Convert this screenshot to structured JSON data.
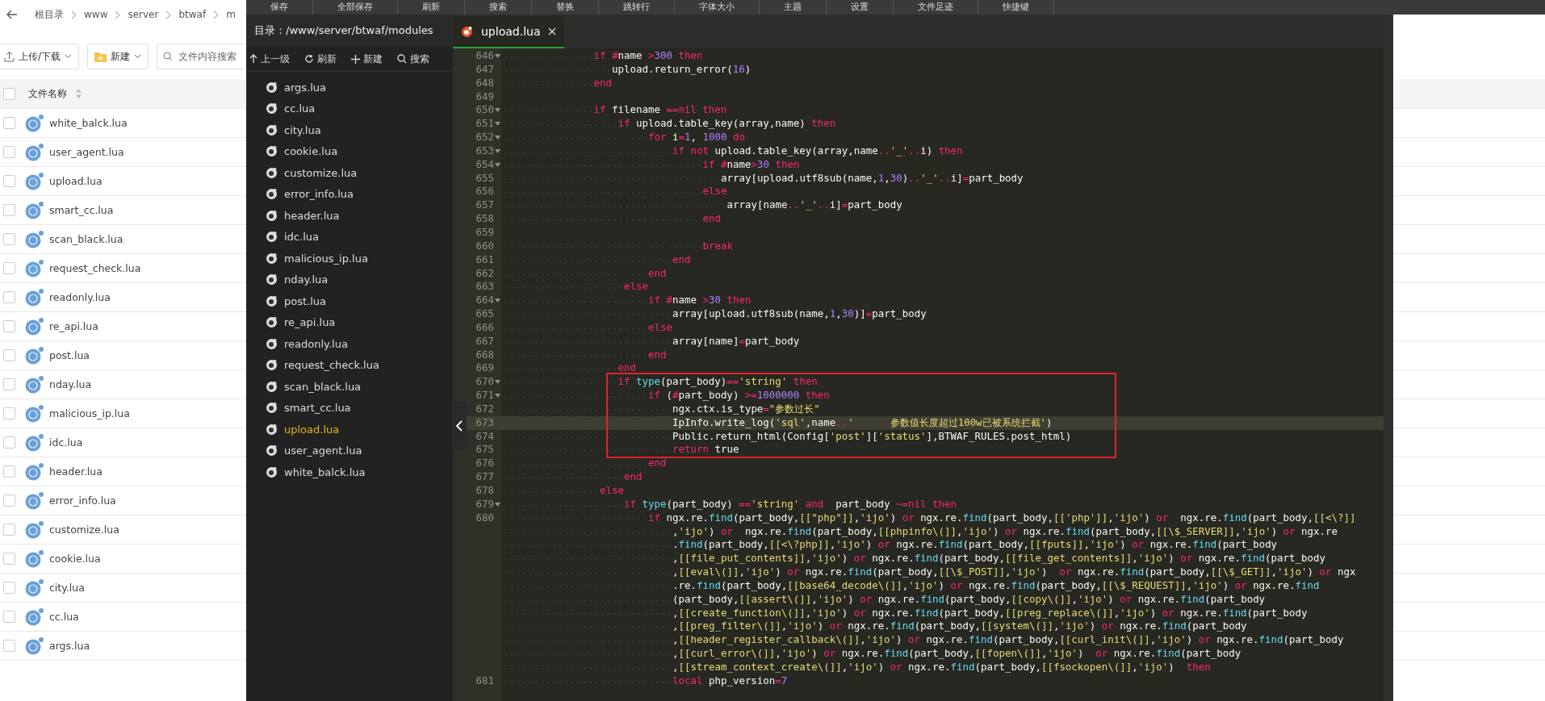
{
  "toolbar": [
    "保存",
    "全部保存",
    "刷新",
    "搜索",
    "替换",
    "跳转行",
    "字体大小",
    "主题",
    "设置",
    "文件足迹",
    "快捷键"
  ],
  "file_manager": {
    "breadcrumb": [
      "根目录",
      "www",
      "server",
      "btwaf",
      "m"
    ],
    "upload_button": "上传/下载",
    "new_button": "新建",
    "search": {
      "placeholder": "文件内容搜索"
    },
    "select_all_checked": false,
    "column": "文件名称",
    "files": [
      {
        "name": "white_balck.lua",
        "checked": false
      },
      {
        "name": "user_agent.lua",
        "checked": false
      },
      {
        "name": "upload.lua",
        "checked": false
      },
      {
        "name": "smart_cc.lua",
        "checked": false
      },
      {
        "name": "scan_black.lua",
        "checked": false
      },
      {
        "name": "request_check.lua",
        "checked": false
      },
      {
        "name": "readonly.lua",
        "checked": false
      },
      {
        "name": "re_api.lua",
        "checked": false
      },
      {
        "name": "post.lua",
        "checked": false
      },
      {
        "name": "nday.lua",
        "checked": false
      },
      {
        "name": "malicious_ip.lua",
        "checked": false
      },
      {
        "name": "idc.lua",
        "checked": false
      },
      {
        "name": "header.lua",
        "checked": false
      },
      {
        "name": "error_info.lua",
        "checked": false
      },
      {
        "name": "customize.lua",
        "checked": false
      },
      {
        "name": "cookie.lua",
        "checked": false
      },
      {
        "name": "city.lua",
        "checked": false
      },
      {
        "name": "cc.lua",
        "checked": false
      },
      {
        "name": "args.lua",
        "checked": false
      }
    ]
  },
  "editor": {
    "directory": "目录：/www/server/btwaf/modules",
    "actions": [
      "上一级",
      "刷新",
      "新建",
      "搜索"
    ],
    "files": [
      {
        "name": "args.lua",
        "selected": false
      },
      {
        "name": "cc.lua",
        "selected": false
      },
      {
        "name": "city.lua",
        "selected": false
      },
      {
        "name": "cookie.lua",
        "selected": false
      },
      {
        "name": "customize.lua",
        "selected": false
      },
      {
        "name": "error_info.lua",
        "selected": false
      },
      {
        "name": "header.lua",
        "selected": false
      },
      {
        "name": "idc.lua",
        "selected": false
      },
      {
        "name": "malicious_ip.lua",
        "selected": false
      },
      {
        "name": "nday.lua",
        "selected": false
      },
      {
        "name": "post.lua",
        "selected": false
      },
      {
        "name": "re_api.lua",
        "selected": false
      },
      {
        "name": "readonly.lua",
        "selected": false
      },
      {
        "name": "request_check.lua",
        "selected": false
      },
      {
        "name": "scan_black.lua",
        "selected": false
      },
      {
        "name": "smart_cc.lua",
        "selected": false
      },
      {
        "name": "upload.lua",
        "selected": true
      },
      {
        "name": "user_agent.lua",
        "selected": false
      },
      {
        "name": "white_balck.lua",
        "selected": false
      }
    ],
    "tab": "upload.lua",
    "lines": [
      {
        "kind": "line",
        "number": "646",
        "foldable": true,
        "current": false,
        "text": "               if #name >300 then"
      },
      {
        "kind": "line",
        "number": "647",
        "foldable": false,
        "current": false,
        "text": "                  upload.return_error(16)"
      },
      {
        "kind": "line",
        "number": "648",
        "foldable": false,
        "current": false,
        "text": "               end"
      },
      {
        "kind": "line",
        "number": "649",
        "foldable": false,
        "current": false
      },
      {
        "kind": "line",
        "number": "650",
        "foldable": true,
        "current": false,
        "text": "               if filename ==nil then"
      },
      {
        "kind": "line",
        "number": "651",
        "foldable": true,
        "current": false,
        "text": "                   if upload.table_key(array,name) then"
      },
      {
        "kind": "line",
        "number": "652",
        "foldable": true,
        "current": false,
        "text": "                        for i=1, 1000 do"
      },
      {
        "kind": "line",
        "number": "653",
        "foldable": true,
        "current": false,
        "text": "                            if not upload.table_key(array,name..'_'..i) then"
      },
      {
        "kind": "line",
        "number": "654",
        "foldable": true,
        "current": false,
        "text": "                                 if #name>30 then"
      },
      {
        "kind": "line",
        "number": "655",
        "foldable": false,
        "current": false,
        "text": "                                    array[upload.utf8sub(name,1,30)..'_'..i]=part_body"
      },
      {
        "kind": "line",
        "number": "656",
        "foldable": false,
        "current": false,
        "text": "                                 else"
      },
      {
        "kind": "line",
        "number": "657",
        "foldable": false,
        "current": false,
        "text": "                                     array[name..'_'..i]=part_body"
      },
      {
        "kind": "line",
        "number": "658",
        "foldable": false,
        "current": false,
        "text": "                                 end"
      },
      {
        "kind": "line",
        "number": "659",
        "foldable": false,
        "current": false
      },
      {
        "kind": "line",
        "number": "660",
        "foldable": false,
        "current": false,
        "text": "                                 break"
      },
      {
        "kind": "line",
        "number": "661",
        "foldable": false,
        "current": false,
        "text": "                            end"
      },
      {
        "kind": "line",
        "number": "662",
        "foldable": false,
        "current": false,
        "text": "                        end"
      },
      {
        "kind": "line",
        "number": "663",
        "foldable": false,
        "current": false,
        "text": "                    else"
      },
      {
        "kind": "line",
        "number": "664",
        "foldable": true,
        "current": false,
        "text": "                        if #name >30 then"
      },
      {
        "kind": "line",
        "number": "665",
        "foldable": false,
        "current": false,
        "text": "                            array[upload.utf8sub(name,1,30)]=part_body"
      },
      {
        "kind": "line",
        "number": "666",
        "foldable": false,
        "current": false,
        "text": "                        else"
      },
      {
        "kind": "line",
        "number": "667",
        "foldable": false,
        "current": false,
        "text": "                            array[name]=part_body"
      },
      {
        "kind": "line",
        "number": "668",
        "foldable": false,
        "current": false,
        "text": "                        end"
      },
      {
        "kind": "line",
        "number": "669",
        "foldable": false,
        "current": false,
        "text": "                   end"
      },
      {
        "kind": "line",
        "number": "670",
        "foldable": true,
        "current": false,
        "text": "                   if type(part_body)=='string' then"
      },
      {
        "kind": "line",
        "number": "671",
        "foldable": true,
        "current": false,
        "text": "                        if (#part_body) >=1000000 then"
      },
      {
        "kind": "line",
        "number": "672",
        "foldable": false,
        "current": false,
        "text": "                            ngx.ctx.is_type=\"参数过长\""
      },
      {
        "kind": "line",
        "number": "673",
        "foldable": false,
        "current": true,
        "text": "                            IpInfo.write_log('sql',name..'      参数值长度超过100w已被系统拦截')"
      },
      {
        "kind": "line",
        "number": "674",
        "foldable": false,
        "current": false,
        "text": "                            Public.return_html(Config['post']['status'],BTWAF_RULES.post_html)"
      },
      {
        "kind": "line",
        "number": "675",
        "foldable": false,
        "current": false,
        "text": "                            return true"
      },
      {
        "kind": "line",
        "number": "676",
        "foldable": false,
        "current": false,
        "text": "                        end"
      },
      {
        "kind": "line",
        "number": "677",
        "foldable": false,
        "current": false,
        "text": "                    end"
      },
      {
        "kind": "line",
        "number": "678",
        "foldable": false,
        "current": false,
        "text": "                else"
      },
      {
        "kind": "line",
        "number": "679",
        "foldable": true,
        "current": false,
        "text": "                    if type(part_body) =='string' and  part_body ~=nil then"
      },
      {
        "kind": "line",
        "number": "680",
        "foldable": false,
        "current": false,
        "text": "                        if ngx.re.find(part_body,[[\"php\"]],'ijo') or ngx.re.find(part_body,[['php']],'ijo') or  ngx.re.find(part_body,[[<\\?]]"
      },
      {
        "kind": "wrap",
        "text": "                            ,'ijo') or  ngx.re.find(part_body,[[phpinfo\\(]],'ijo') or ngx.re.find(part_body,[[\\$_SERVER]],'ijo') or ngx.re"
      },
      {
        "kind": "wrap",
        "text": "                            .find(part_body,[[<\\?php]],'ijo') or ngx.re.find(part_body,[[fputs]],'ijo') or ngx.re.find(part_body"
      },
      {
        "kind": "wrap",
        "text": "                            ,[[file_put_contents]],'ijo') or ngx.re.find(part_body,[[file_get_contents]],'ijo') or ngx.re.find(part_body"
      },
      {
        "kind": "wrap",
        "text": "                            ,[[eval\\(]],'ijo') or ngx.re.find(part_body,[[\\$_POST]],'ijo')  or ngx.re.find(part_body,[[\\$_GET]],'ijo') or ngx"
      },
      {
        "kind": "wrap",
        "text": "                            .re.find(part_body,[[base64_decode\\(]],'ijo') or ngx.re.find(part_body,[[\\$_REQUEST]],'ijo') or ngx.re.find"
      },
      {
        "kind": "wrap",
        "text": "                            (part_body,[[assert\\(]],'ijo') or ngx.re.find(part_body,[[copy\\(]],'ijo') or ngx.re.find(part_body"
      },
      {
        "kind": "wrap",
        "text": "                            ,[[create_function\\(]],'ijo') or ngx.re.find(part_body,[[preg_replace\\(]],'ijo') or ngx.re.find(part_body"
      },
      {
        "kind": "wrap",
        "text": "                            ,[[preg_filter\\(]],'ijo') or ngx.re.find(part_body,[[system\\(]],'ijo') or ngx.re.find(part_body"
      },
      {
        "kind": "wrap",
        "text": "                            ,[[header_register_callback\\(]],'ijo') or ngx.re.find(part_body,[[curl_init\\(]],'ijo') or ngx.re.find(part_body"
      },
      {
        "kind": "wrap",
        "text": "                            ,[[curl_error\\(]],'ijo') or ngx.re.find(part_body,[[fopen\\(]],'ijo')  or ngx.re.find(part_body"
      },
      {
        "kind": "wrap",
        "text": "                            ,[[stream_context_create\\(]],'ijo') or ngx.re.find(part_body,[[fsockopen\\(]],'ijo')  then"
      },
      {
        "kind": "line",
        "number": "681",
        "foldable": false,
        "current": false,
        "text": "                            local php_version=7"
      }
    ]
  }
}
